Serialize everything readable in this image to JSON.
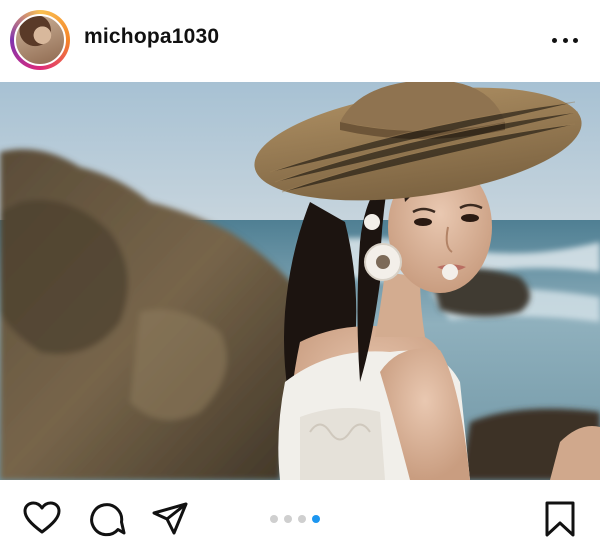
{
  "post": {
    "username": "michopa1030",
    "carousel": {
      "total": 4,
      "active": 4
    }
  },
  "icons": {
    "more": "more-options-icon",
    "like": "heart-icon",
    "comment": "comment-icon",
    "share": "send-icon",
    "save": "bookmark-icon"
  },
  "colors": {
    "active_dot": "#1c96f0",
    "inactive_dot": "#cfcfcf"
  }
}
